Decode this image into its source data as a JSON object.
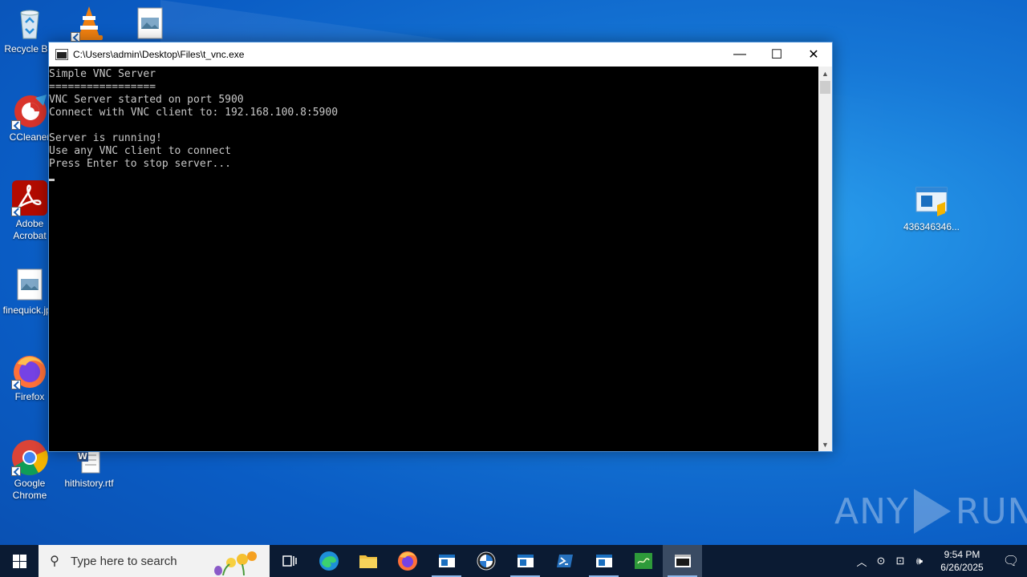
{
  "desktop": {
    "icons": [
      {
        "label": "Recycle Bin"
      },
      {
        "label": "CCleaner"
      },
      {
        "label": "Adobe Acrobat"
      },
      {
        "label": "finequick.jpg"
      },
      {
        "label": "Firefox"
      },
      {
        "label": "Google Chrome"
      },
      {
        "label": "hithistory.rtf"
      },
      {
        "label": "436346346..."
      }
    ]
  },
  "window": {
    "title": "C:\\Users\\admin\\Desktop\\Files\\t_vnc.exe",
    "minimize_glyph": "—",
    "maximize_glyph": "☐",
    "close_glyph": "✕",
    "console_lines": [
      "Simple VNC Server",
      "=================",
      "VNC Server started on port 5900",
      "Connect with VNC client to: 192.168.100.8:5900",
      "",
      "Server is running!",
      "Use any VNC client to connect",
      "Press Enter to stop server..."
    ]
  },
  "watermark": {
    "left": "ANY",
    "right": "RUN"
  },
  "taskbar": {
    "search_placeholder": "Type here to search",
    "apps": [
      "task-view",
      "edge",
      "file-explorer",
      "firefox",
      "app-window",
      "bmw-app",
      "app-window-2",
      "powershell",
      "app-window-3",
      "green-app",
      "console-app"
    ],
    "tray": {
      "time": "9:54 PM",
      "date": "6/26/2025"
    }
  }
}
